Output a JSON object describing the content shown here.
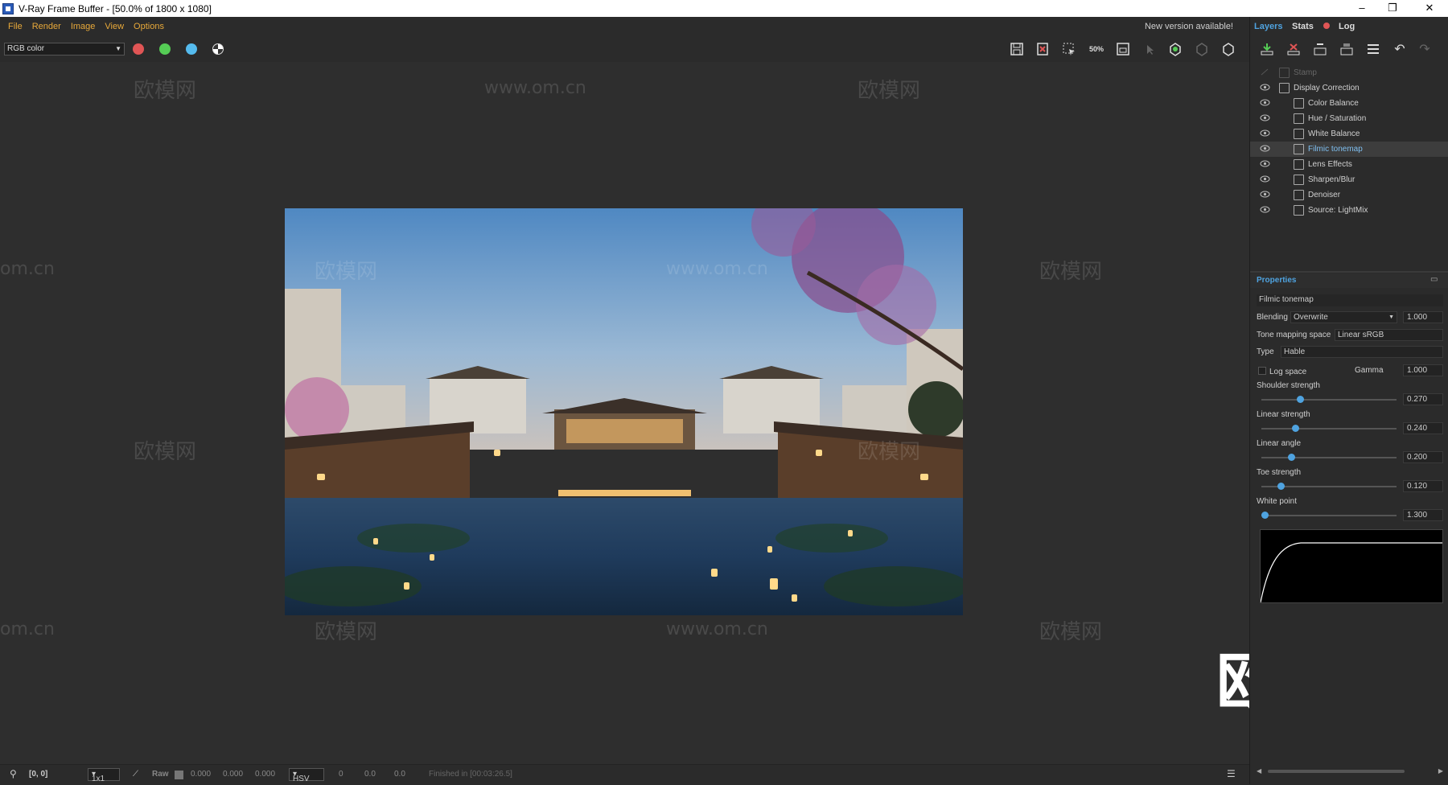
{
  "window": {
    "title": "V-Ray Frame Buffer - [50.0% of 1800 x 1080]"
  },
  "menu": {
    "file": "File",
    "render": "Render",
    "image": "Image",
    "view": "View",
    "options": "Options",
    "new_version": "New version available!"
  },
  "toolbar": {
    "channel": "RGB color",
    "zoom_label": "50%"
  },
  "colors": {
    "accent_menu": "#e8a93a",
    "accent_tab": "#4fa3e0",
    "red": "#e05555",
    "green": "#55cc55",
    "blue": "#55bbee"
  },
  "sidebar": {
    "tabs": {
      "layers": "Layers",
      "stats": "Stats",
      "log": "Log"
    },
    "layers": [
      {
        "name": "Stamp",
        "icon": "stamp-icon"
      },
      {
        "name": "Display Correction",
        "icon": "curve-icon"
      },
      {
        "name": "Color Balance",
        "icon": "balance-icon"
      },
      {
        "name": "Hue / Saturation",
        "icon": "hue-icon"
      },
      {
        "name": "White Balance",
        "icon": "white-balance-icon"
      },
      {
        "name": "Filmic tonemap",
        "icon": "filmic-icon"
      },
      {
        "name": "Lens Effects",
        "icon": "lens-icon"
      },
      {
        "name": "Sharpen/Blur",
        "icon": "sharpen-icon"
      },
      {
        "name": "Denoiser",
        "icon": "denoiser-icon"
      },
      {
        "name": "Source: LightMix",
        "icon": "lightmix-icon"
      }
    ],
    "properties": {
      "header": "Properties",
      "layer_name": "Filmic tonemap",
      "blending_label": "Blending",
      "blending_value": "Overwrite",
      "blending_amount": "1.000",
      "tone_space_label": "Tone mapping space",
      "tone_space_value": "Linear sRGB",
      "type_label": "Type",
      "type_value": "Hable",
      "log_space_label": "Log space",
      "gamma_label": "Gamma",
      "gamma_value": "1.000",
      "shoulder_label": "Shoulder strength",
      "shoulder_value": "0.270",
      "linear_strength_label": "Linear strength",
      "linear_strength_value": "0.240",
      "linear_angle_label": "Linear angle",
      "linear_angle_value": "0.200",
      "toe_label": "Toe strength",
      "toe_value": "0.120",
      "white_point_label": "White point",
      "white_point_value": "1.300"
    }
  },
  "status": {
    "coords": "[0, 0]",
    "zoom": "1x1",
    "raw": "Raw",
    "r": "0.000",
    "g": "0.000",
    "b": "0.000",
    "mode": "HSV",
    "h": "0",
    "s": "0.0",
    "v": "0.0",
    "finished": "Finished in [00:03:26.5]"
  },
  "watermarks": {
    "cn": "欧模网",
    "url": "www.om.cn",
    "url_partial": "om.cn",
    "url_cut": "www."
  }
}
